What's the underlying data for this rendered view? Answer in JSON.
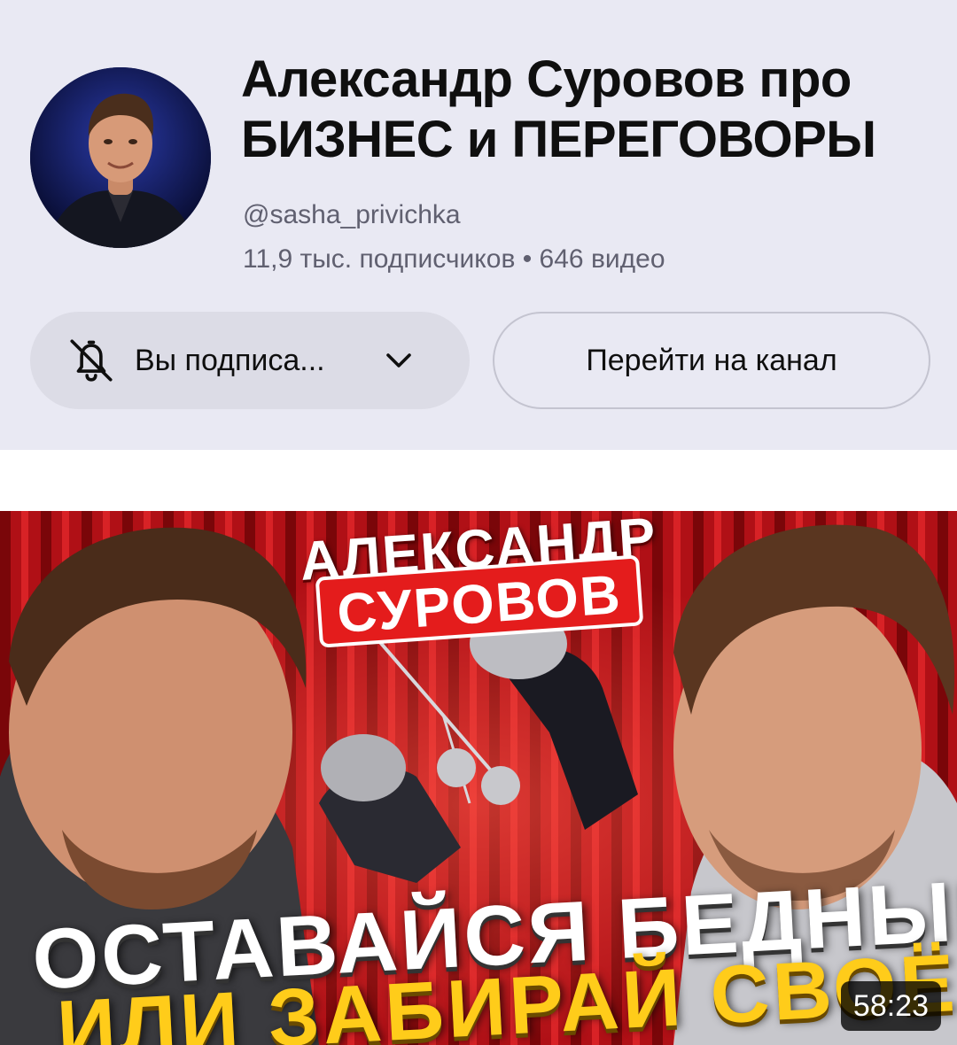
{
  "channel": {
    "title_line1": "Александр Суровов про",
    "title_line2": "БИЗНЕС и ПЕРЕГОВОРЫ",
    "handle": "@sasha_privichka",
    "stats": "11,9 тыс. подписчиков • 646 видео",
    "avatar_icon": "channel-avatar-photo"
  },
  "actions": {
    "subscribed_label": "Вы подписа...",
    "subscribed_icon": "bell-off-icon",
    "dropdown_icon": "chevron-down-icon",
    "go_to_channel_label": "Перейти на канал"
  },
  "video": {
    "thumb_name_line1": "АЛЕКСАНДР",
    "thumb_name_line2": "СУРОВОВ",
    "thumb_text_line1": "ОСТАВАЙСЯ БЕДНЫМ",
    "thumb_text_line2": "ИЛИ ЗАБИРАЙ СВОЁ",
    "duration": "58:23"
  },
  "colors": {
    "card_bg": "#e9e9f3",
    "button_bg": "#dcdce6",
    "thumb_red": "#c2121a",
    "thumb_yellow": "#ffcc1a",
    "name_badge": "#e41c1c"
  }
}
